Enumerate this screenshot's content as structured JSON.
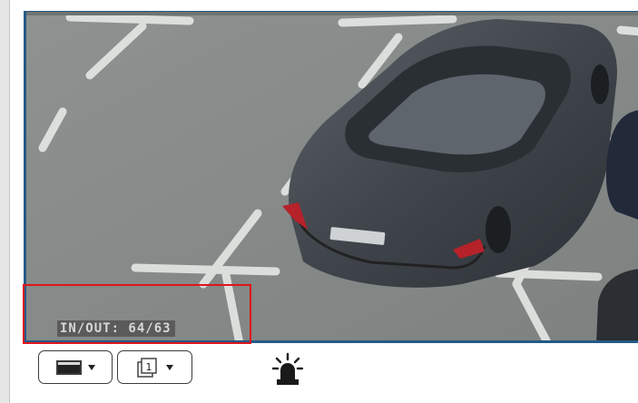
{
  "video": {
    "osd_text": "IN/OUT: 64/63",
    "highlight_color": "#e0151c",
    "border_color": "#245a86"
  },
  "toolbar": {
    "camera_button_icon": "camera-view-icon",
    "layout_button_icon": "layout-1-icon",
    "layout_number": "1",
    "alarm_icon": "alarm-beacon-icon"
  }
}
